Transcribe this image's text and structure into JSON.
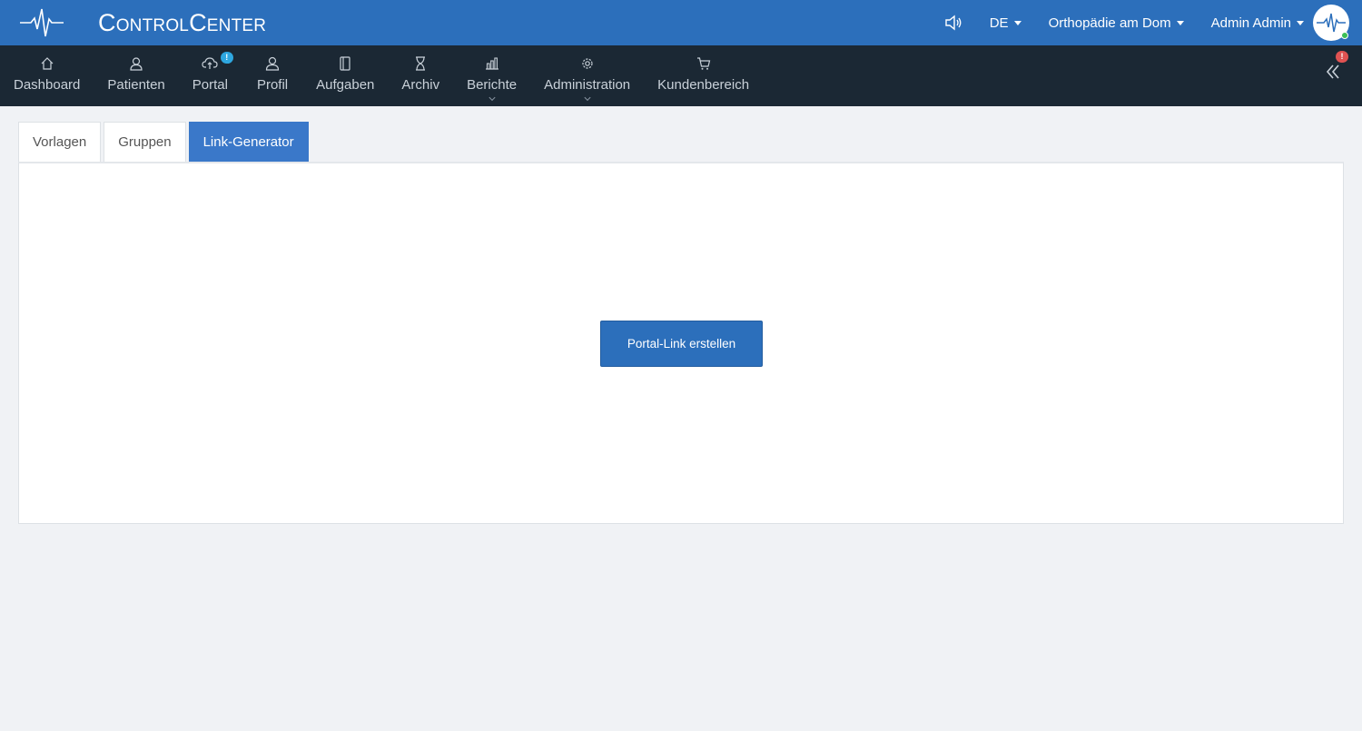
{
  "header": {
    "brand": "ControlCenter",
    "language": "DE",
    "practice": "Orthopädie am Dom",
    "user": "Admin Admin"
  },
  "nav": {
    "items": [
      {
        "label": "Dashboard",
        "icon": "home-icon"
      },
      {
        "label": "Patienten",
        "icon": "patients-icon"
      },
      {
        "label": "Portal",
        "icon": "cloud-icon",
        "badge": "!"
      },
      {
        "label": "Profil",
        "icon": "user-icon"
      },
      {
        "label": "Aufgaben",
        "icon": "notebook-icon"
      },
      {
        "label": "Archiv",
        "icon": "hourglass-icon"
      },
      {
        "label": "Berichte",
        "icon": "bar-chart-icon"
      },
      {
        "label": "Administration",
        "icon": "gear-icon"
      },
      {
        "label": "Kundenbereich",
        "icon": "cart-icon"
      }
    ],
    "collapse_badge": "!"
  },
  "tabs": [
    {
      "label": "Vorlagen",
      "active": false
    },
    {
      "label": "Gruppen",
      "active": false
    },
    {
      "label": "Link-Generator",
      "active": true
    }
  ],
  "main": {
    "button_label": "Portal-Link erstellen"
  },
  "colors": {
    "header_bg": "#2c6fbb",
    "nav_bg": "#1b2834",
    "active_tab": "#3a78c9",
    "badge_blue": "#2ea7e0",
    "badge_red": "#e05252",
    "online": "#3cbf57"
  }
}
